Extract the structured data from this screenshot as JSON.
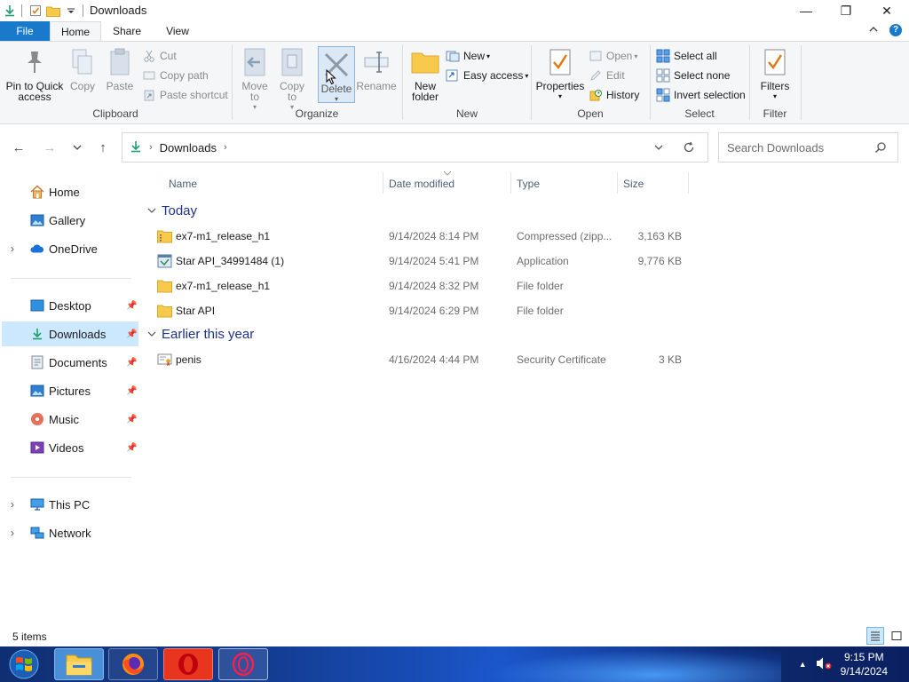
{
  "window": {
    "title": "Downloads",
    "controls": {
      "minimize": "—",
      "restore": "❐",
      "close": "✕"
    }
  },
  "ribbon": {
    "tabs": [
      {
        "label": "File"
      },
      {
        "label": "Home"
      },
      {
        "label": "Share"
      },
      {
        "label": "View"
      }
    ],
    "clipboard": {
      "group_label": "Clipboard",
      "pin": "Pin to Quick access",
      "copy": "Copy",
      "paste": "Paste",
      "cut": "Cut",
      "copy_path": "Copy path",
      "paste_shortcut": "Paste shortcut"
    },
    "organize": {
      "group_label": "Organize",
      "move_to": "Move to",
      "copy_to": "Copy to",
      "delete": "Delete",
      "rename": "Rename"
    },
    "new": {
      "group_label": "New",
      "new_folder": "New folder",
      "new_item": "New",
      "easy_access": "Easy access"
    },
    "open": {
      "group_label": "Open",
      "properties": "Properties",
      "open": "Open",
      "edit": "Edit",
      "history": "History"
    },
    "select": {
      "group_label": "Select",
      "select_all": "Select all",
      "select_none": "Select none",
      "invert": "Invert selection"
    },
    "filter": {
      "group_label": "Filter",
      "filters": "Filters"
    }
  },
  "address": {
    "crumb": "Downloads",
    "search_placeholder": "Search Downloads"
  },
  "nav": {
    "items": [
      {
        "label": "Home"
      },
      {
        "label": "Gallery"
      },
      {
        "label": "OneDrive"
      },
      {
        "label": "Desktop"
      },
      {
        "label": "Downloads"
      },
      {
        "label": "Documents"
      },
      {
        "label": "Pictures"
      },
      {
        "label": "Music"
      },
      {
        "label": "Videos"
      },
      {
        "label": "This PC"
      },
      {
        "label": "Network"
      }
    ]
  },
  "list": {
    "columns": {
      "name": "Name",
      "date": "Date modified",
      "type": "Type",
      "size": "Size"
    },
    "groups": [
      {
        "label": "Today"
      },
      {
        "label": "Earlier this year"
      }
    ],
    "files": [
      {
        "name": "ex7-m1_release_h1",
        "date": "9/14/2024 8:14 PM",
        "type": "Compressed (zipp...",
        "size": "3,163 KB",
        "icon": "zip-folder-icon"
      },
      {
        "name": "Star API_34991484 (1)",
        "date": "9/14/2024 5:41 PM",
        "type": "Application",
        "size": "9,776 KB",
        "icon": "application-icon"
      },
      {
        "name": "ex7-m1_release_h1",
        "date": "9/14/2024 8:32 PM",
        "type": "File folder",
        "size": "",
        "icon": "folder-icon"
      },
      {
        "name": "Star API",
        "date": "9/14/2024 6:29 PM",
        "type": "File folder",
        "size": "",
        "icon": "folder-icon"
      },
      {
        "name": "penis",
        "date": "4/16/2024 4:44 PM",
        "type": "Security Certificate",
        "size": "3 KB",
        "icon": "certificate-icon"
      }
    ]
  },
  "status": {
    "items": "5 items"
  },
  "taskbar": {
    "time": "9:15 PM",
    "date": "9/14/2024"
  },
  "colors": {
    "accent": "#1979ca",
    "selection": "#cce8ff",
    "group_header": "#1e3287",
    "folder": "#f8c94a"
  }
}
